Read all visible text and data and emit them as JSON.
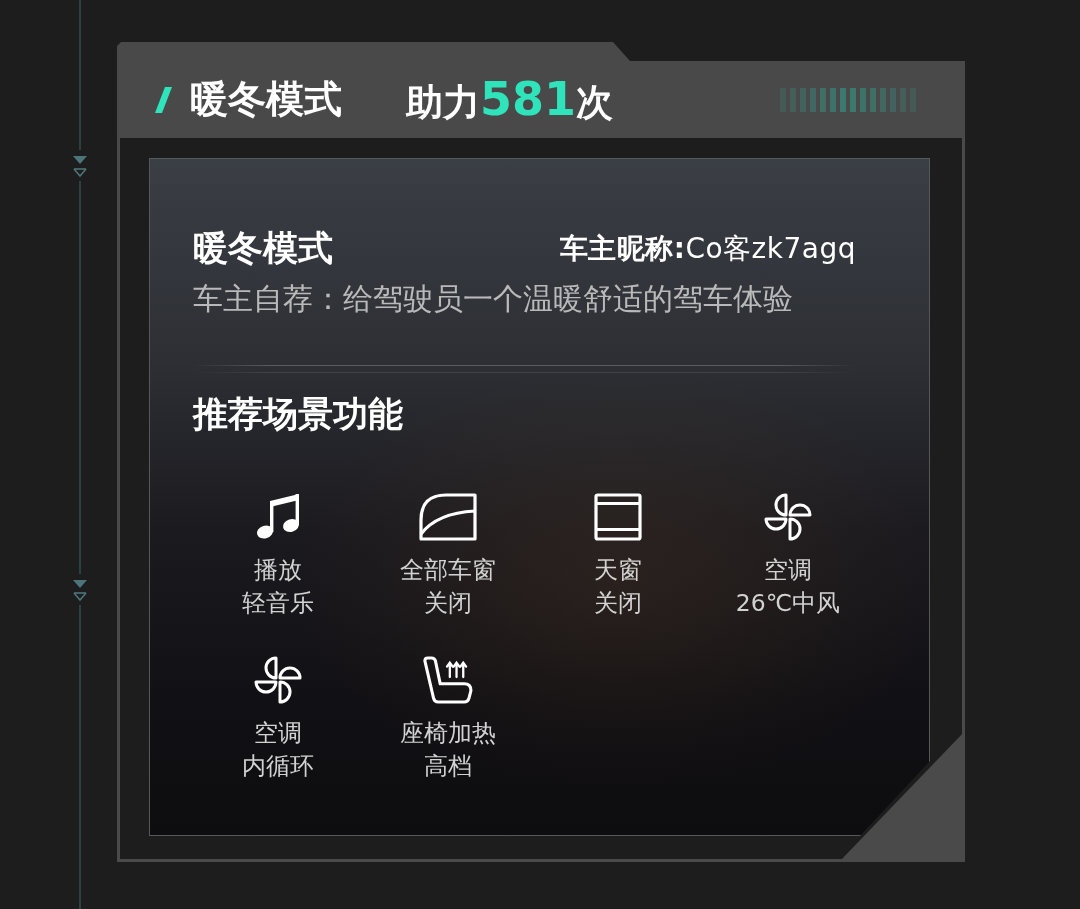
{
  "header": {
    "title": "暖冬模式",
    "boost": {
      "prefix": "助力",
      "count": "581",
      "suffix": "次"
    }
  },
  "card": {
    "title": "暖冬模式",
    "owner": "**车主昵称:**Co客zk7agq",
    "description": "车主自荐：给驾驶员一个温暖舒适的驾车体验"
  },
  "section": {
    "title": "推荐场景功能",
    "features": [
      {
        "kind": "music",
        "name": "播放",
        "setting": "轻音乐"
      },
      {
        "kind": "window",
        "name": "全部车窗",
        "setting": "关闭"
      },
      {
        "kind": "sunroof",
        "name": "天窗",
        "setting": "关闭"
      },
      {
        "kind": "fan",
        "name": "空调",
        "setting": "26℃中风"
      },
      {
        "kind": "fan",
        "name": "空调",
        "setting": "内循环"
      },
      {
        "kind": "seat_heat",
        "name": "座椅加热",
        "setting": "高档"
      }
    ]
  }
}
